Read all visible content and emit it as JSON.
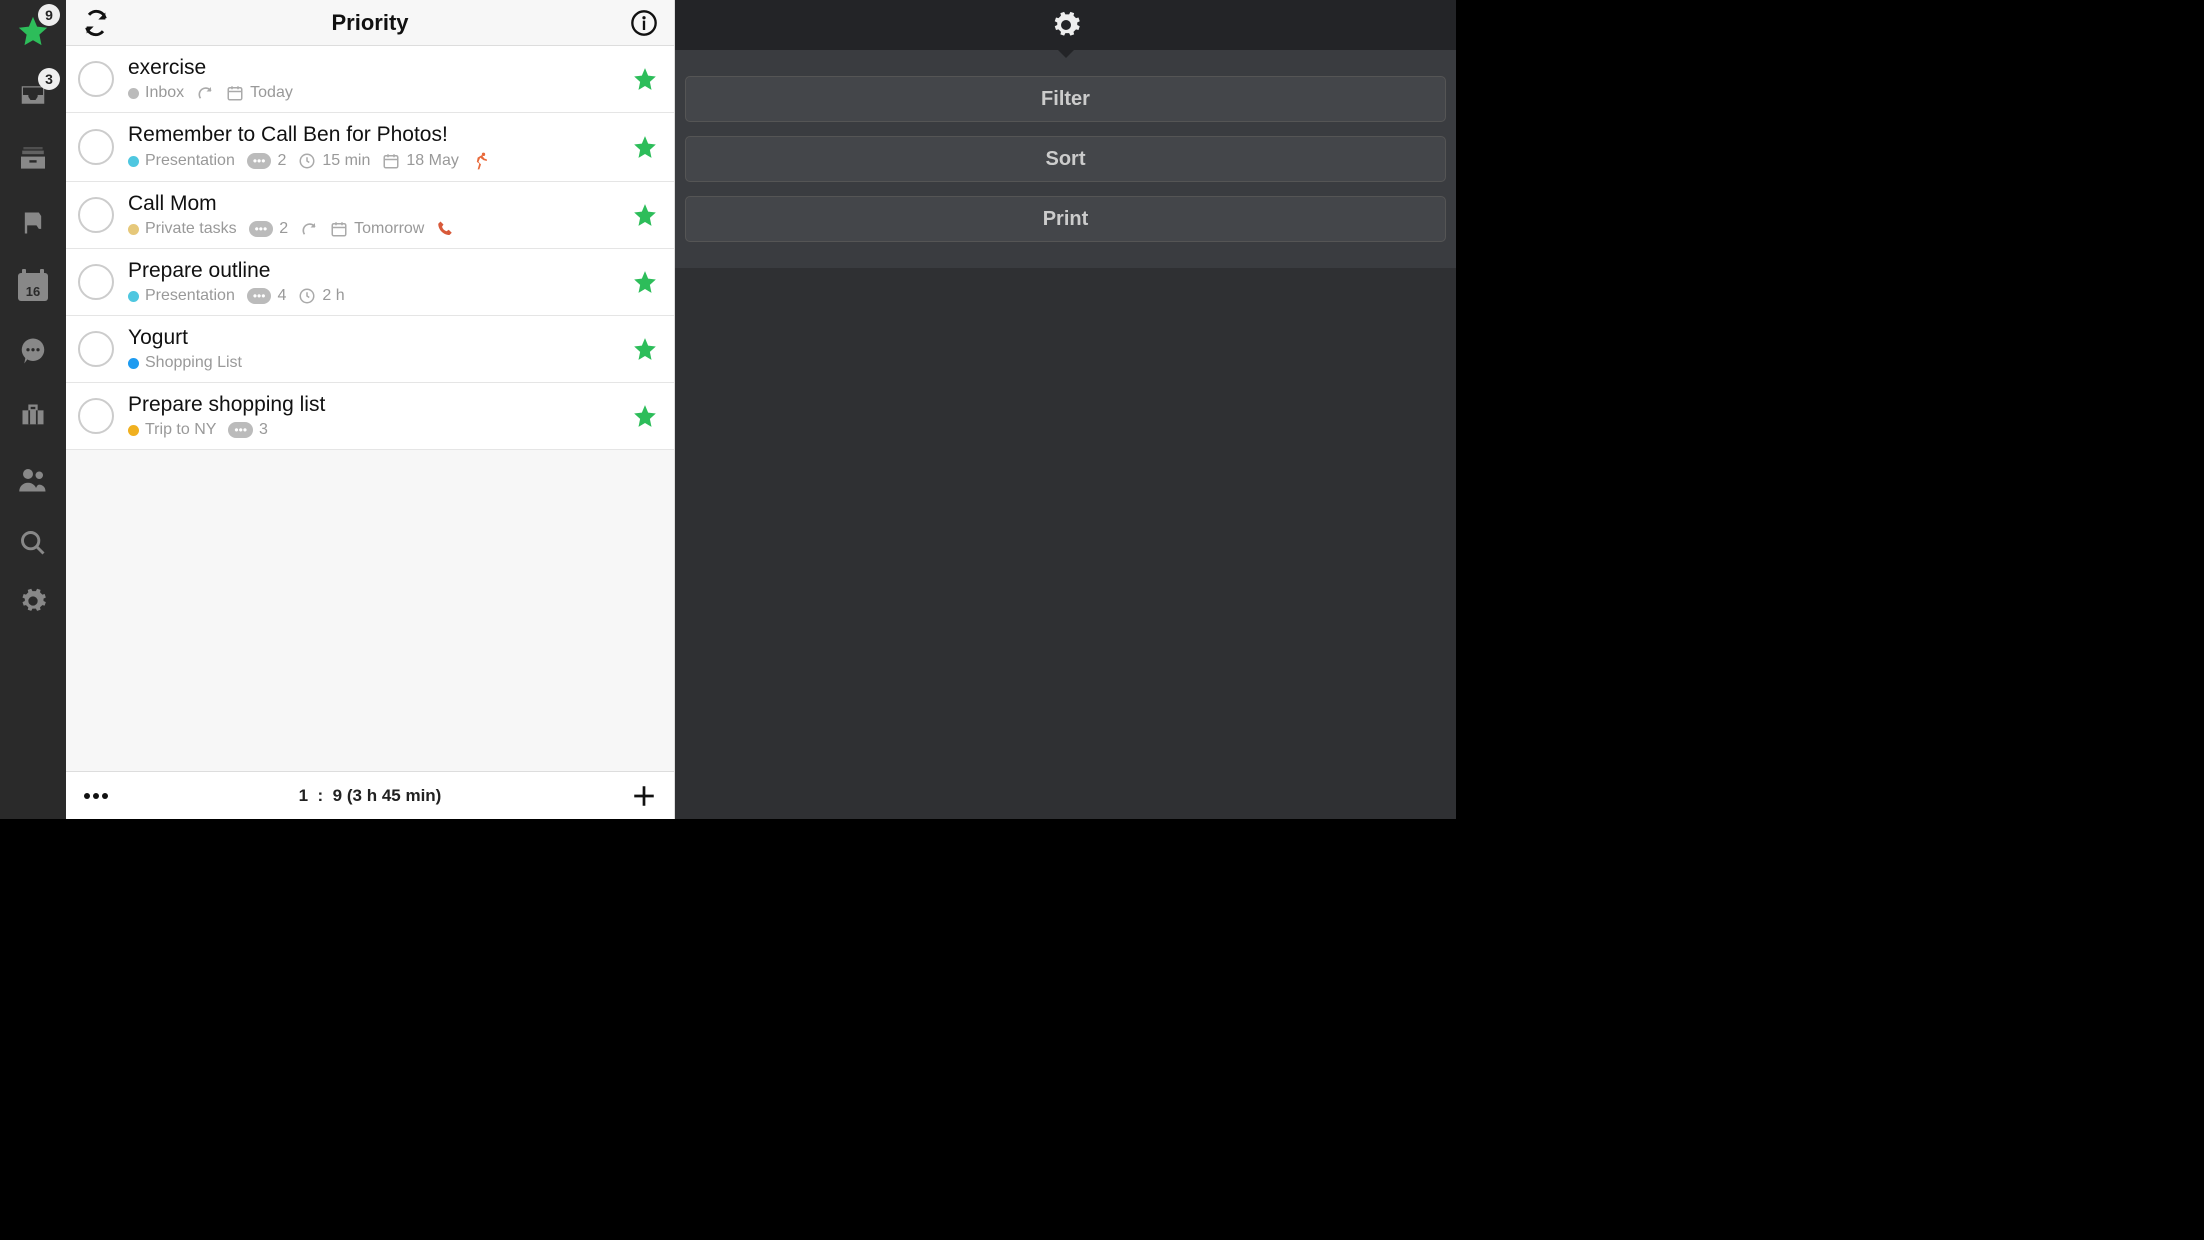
{
  "sidebar": {
    "priority_badge": "9",
    "inbox_badge": "3",
    "calendar_day": "16"
  },
  "header": {
    "title": "Priority"
  },
  "tasks": [
    {
      "title": "exercise",
      "list": "Inbox",
      "list_color": "#bbbbbb",
      "recurs": true,
      "date": "Today",
      "comments": null,
      "duration": null,
      "extra": null
    },
    {
      "title": "Remember to Call Ben for Photos!",
      "list": "Presentation",
      "list_color": "#4fc7e0",
      "recurs": false,
      "date": "18 May",
      "comments": "2",
      "duration": "15 min",
      "extra": "run"
    },
    {
      "title": "Call Mom",
      "list": "Private tasks",
      "list_color": "#e6c87a",
      "recurs": true,
      "date": "Tomorrow",
      "comments": "2",
      "duration": null,
      "extra": "phone"
    },
    {
      "title": "Prepare outline",
      "list": "Presentation",
      "list_color": "#4fc7e0",
      "recurs": false,
      "date": null,
      "comments": "4",
      "duration": "2 h",
      "extra": null
    },
    {
      "title": "Yogurt",
      "list": "Shopping List",
      "list_color": "#1e9bf0",
      "recurs": false,
      "date": null,
      "comments": null,
      "duration": null,
      "extra": null
    },
    {
      "title": "Prepare shopping list",
      "list": "Trip to NY",
      "list_color": "#f0b020",
      "recurs": false,
      "date": null,
      "comments": "3",
      "duration": null,
      "extra": null
    }
  ],
  "footer": {
    "current": "1",
    "total": "9",
    "summary": "(3 h 45 min)"
  },
  "panel": {
    "filter": "Filter",
    "sort": "Sort",
    "print": "Print"
  }
}
